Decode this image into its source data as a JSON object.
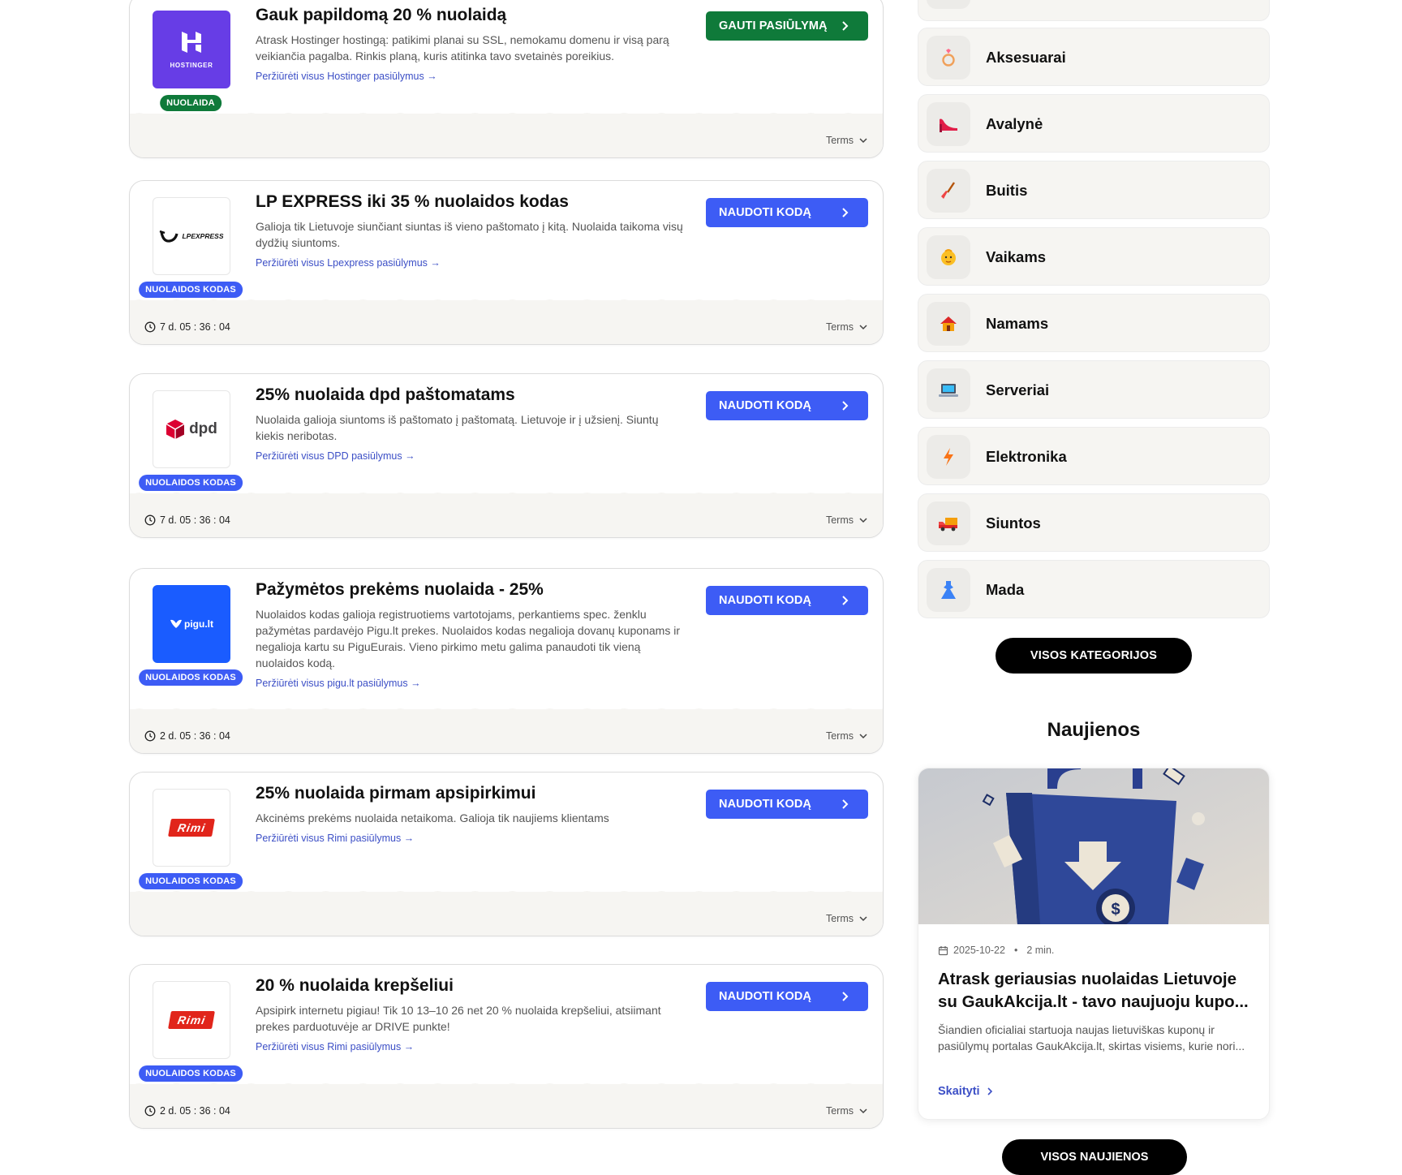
{
  "offers": [
    {
      "title": "Gauk papildomą 20 % nuolaidą",
      "description": "Atrask Hostinger hostingą: patikimi planai su SSL, nemokamu domenu ir visą parą veikiančia pagalba. Rinkis planą, kuris atitinka tavo svetainės poreikius.",
      "link": "Peržiūrėti visus Hostinger pasiūlymus",
      "badge": "NUOLAIDA",
      "cta": "GAUTI PASIŪLYMĄ",
      "timer": "",
      "terms": "Terms",
      "logo_text": "HOSTINGER"
    },
    {
      "title": "LP EXPRESS iki 35 % nuolaidos kodas",
      "description": "Galioja tik Lietuvoje siunčiant siuntas iš vieno paštomato į kitą. Nuolaida taikoma visų dydžių siuntoms.",
      "link": "Peržiūrėti visus Lpexpress pasiūlymus",
      "badge": "NUOLAIDOS KODAS",
      "cta": "NAUDOTI KODĄ",
      "timer": "7 d. 05 : 36 : 04",
      "terms": "Terms",
      "logo_text": "LPEXPRESS"
    },
    {
      "title": "25% nuolaida dpd paštomatams",
      "description": "Nuolaida galioja siuntoms iš paštomato į paštomatą. Lietuvoje ir į užsienį. Siuntų kiekis neribotas.",
      "link": "Peržiūrėti visus DPD pasiūlymus",
      "badge": "NUOLAIDOS KODAS",
      "cta": "NAUDOTI KODĄ",
      "timer": "7 d. 05 : 36 : 04",
      "terms": "Terms",
      "logo_text": "dpd"
    },
    {
      "title": "Pažymėtos prekėms nuolaida - 25%",
      "description": "Nuolaidos kodas galioja registruotiems vartotojams, perkantiems spec. ženklu pažymėtas pardavėjo Pigu.lt prekes. Nuolaidos kodas negalioja dovanų kuponams ir negalioja kartu su PiguEurais. Vieno pirkimo metu galima panaudoti tik vieną nuolaidos kodą.",
      "link": "Peržiūrėti visus pigu.lt pasiūlymus",
      "badge": "NUOLAIDOS KODAS",
      "cta": "NAUDOTI KODĄ",
      "timer": "2 d. 05 : 36 : 04",
      "terms": "Terms",
      "logo_text": "pigu.lt"
    },
    {
      "title": "25% nuolaida pirmam apsipirkimui",
      "description": "Akcinėms prekėms nuolaida netaikoma. Galioja tik naujiems klientams",
      "link": "Peržiūrėti visus Rimi pasiūlymus",
      "badge": "NUOLAIDOS KODAS",
      "cta": "NAUDOTI KODĄ",
      "timer": "",
      "terms": "Terms",
      "logo_text": "Rimi"
    },
    {
      "title": "20 % nuolaida krepšeliui",
      "description": "Apsipirk internetu pigiau! Tik 10 13–10 26 net 20 % nuolaida krepšeliui, atsiimant prekes parduotuvėje ar DRIVE punkte!",
      "link": "Peržiūrėti visus Rimi pasiūlymus",
      "badge": "NUOLAIDOS KODAS",
      "cta": "NAUDOTI KODĄ",
      "timer": "2 d. 05 : 36 : 04",
      "terms": "Terms",
      "logo_text": "Rimi"
    }
  ],
  "categories": [
    {
      "label": "Aksesuarai",
      "icon": "ring-icon"
    },
    {
      "label": "Avalynė",
      "icon": "high-heel-icon"
    },
    {
      "label": "Buitis",
      "icon": "broom-icon"
    },
    {
      "label": "Vaikams",
      "icon": "baby-icon"
    },
    {
      "label": "Namams",
      "icon": "house-icon"
    },
    {
      "label": "Serveriai",
      "icon": "laptop-icon"
    },
    {
      "label": "Elektronika",
      "icon": "lightning-icon"
    },
    {
      "label": "Siuntos",
      "icon": "truck-icon"
    },
    {
      "label": "Mada",
      "icon": "dress-icon"
    }
  ],
  "all_categories_label": "VISOS KATEGORIJOS",
  "news": {
    "heading": "Naujienos",
    "date": "2025-10-22",
    "read_time": "2 min.",
    "title": "Atrask geriausias nuolaidas Lietuvoje su GaukAkcija.lt - tavo naujuoju kupo...",
    "excerpt": "Šiandien oficialiai startuoja naujas lietuviškas kuponų ir pasiūlymų portalas GaukAkcija.lt, skirtas visiems, kurie nori...",
    "read_label": "Skaityti",
    "all_label": "VISOS NAUJIENOS"
  },
  "colors": {
    "green": "#0f7a3a",
    "blue": "#3d5cf5",
    "link": "#3c4fc6",
    "hostinger": "#673de6",
    "pigu": "#1a5cff",
    "rimi": "#e1251b",
    "dpd": "#dc0032"
  }
}
